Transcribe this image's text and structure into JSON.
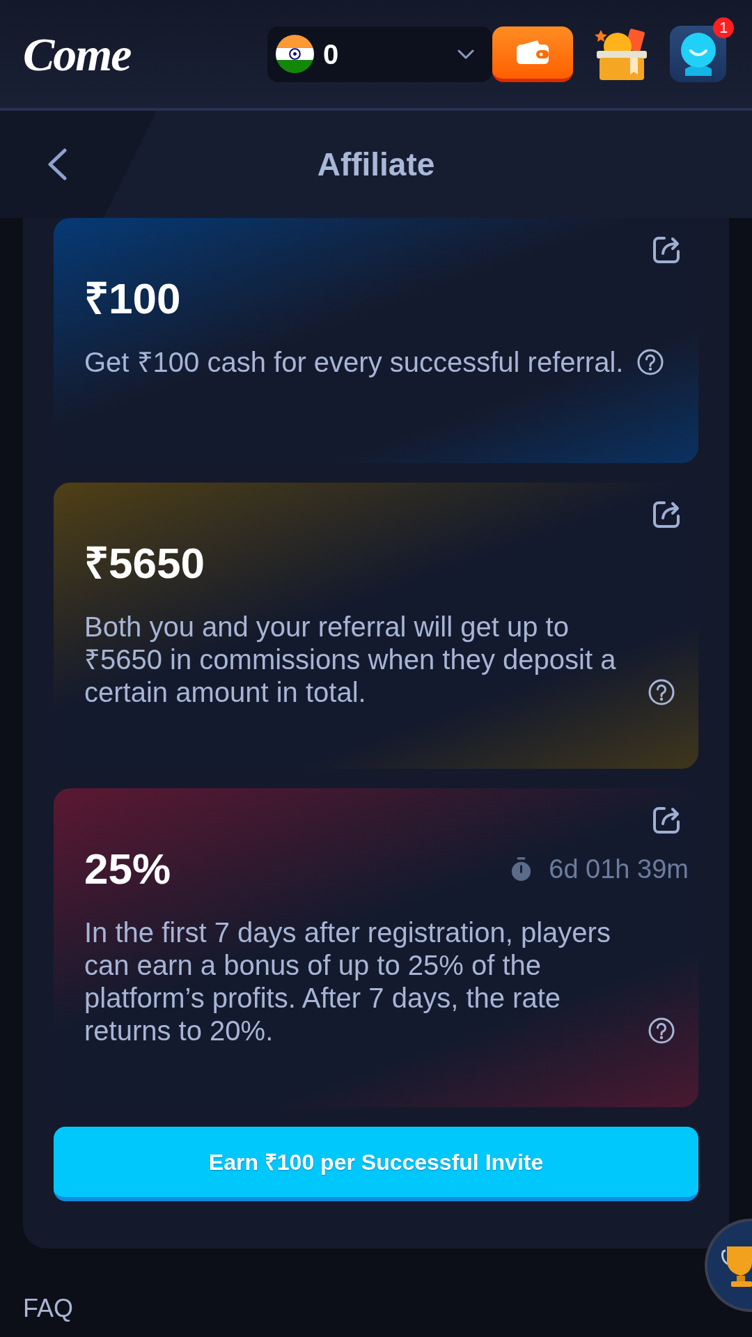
{
  "header": {
    "logo": "Come",
    "balance": {
      "amount": "0"
    },
    "notifications": {
      "count": "1"
    }
  },
  "title_bar": {
    "title": "Affiliate"
  },
  "cards": [
    {
      "amount": "₹100",
      "color": "#063a75",
      "description": "Get ₹100 cash for every successful referral."
    },
    {
      "amount": "₹5650",
      "color": "#4f4015",
      "description": "Both you and your referral will get up to ₹5650 in commissions when they deposit a certain amount in total."
    },
    {
      "amount": "25%",
      "color": "#5c1832",
      "timer": "6d 01h 39m",
      "description": "In the first 7 days after registration, players can earn a bonus of up to 25% of the platform’s profits. After 7 days, the rate returns to 20%."
    }
  ],
  "invite_button": {
    "label": "Earn ₹100 per Successful Invite"
  },
  "faq": {
    "title": "FAQ"
  }
}
